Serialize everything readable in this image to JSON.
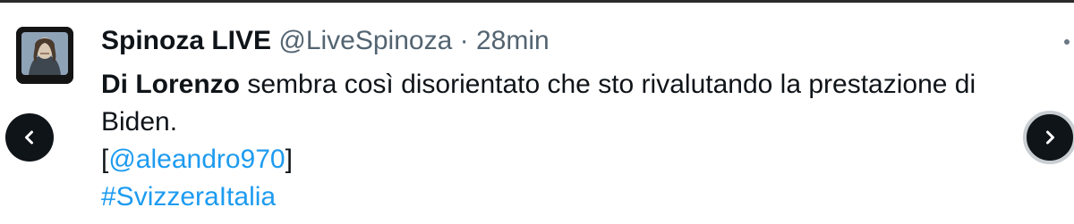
{
  "tweet": {
    "avatar_icon": "portrait-avatar-icon",
    "display_name": "Spinoza LIVE",
    "handle": "@LiveSpinoza",
    "separator": "·",
    "time": "28min",
    "text_bold": "Di Lorenzo",
    "text_rest": "sembra così disorientato che sto rivalutando la prestazione di",
    "text_line2": "Biden.",
    "mention_open": "[",
    "mention": "@aleandro970",
    "mention_close": "]",
    "hashtag": "#SvizzeraItalia"
  },
  "nav": {
    "prev_icon": "chevron-left-icon",
    "next_icon": "chevron-right-icon"
  },
  "colors": {
    "text": "#0f1419",
    "muted": "#536471",
    "link": "#1d9bf0",
    "nav_button": "#0f1419"
  }
}
